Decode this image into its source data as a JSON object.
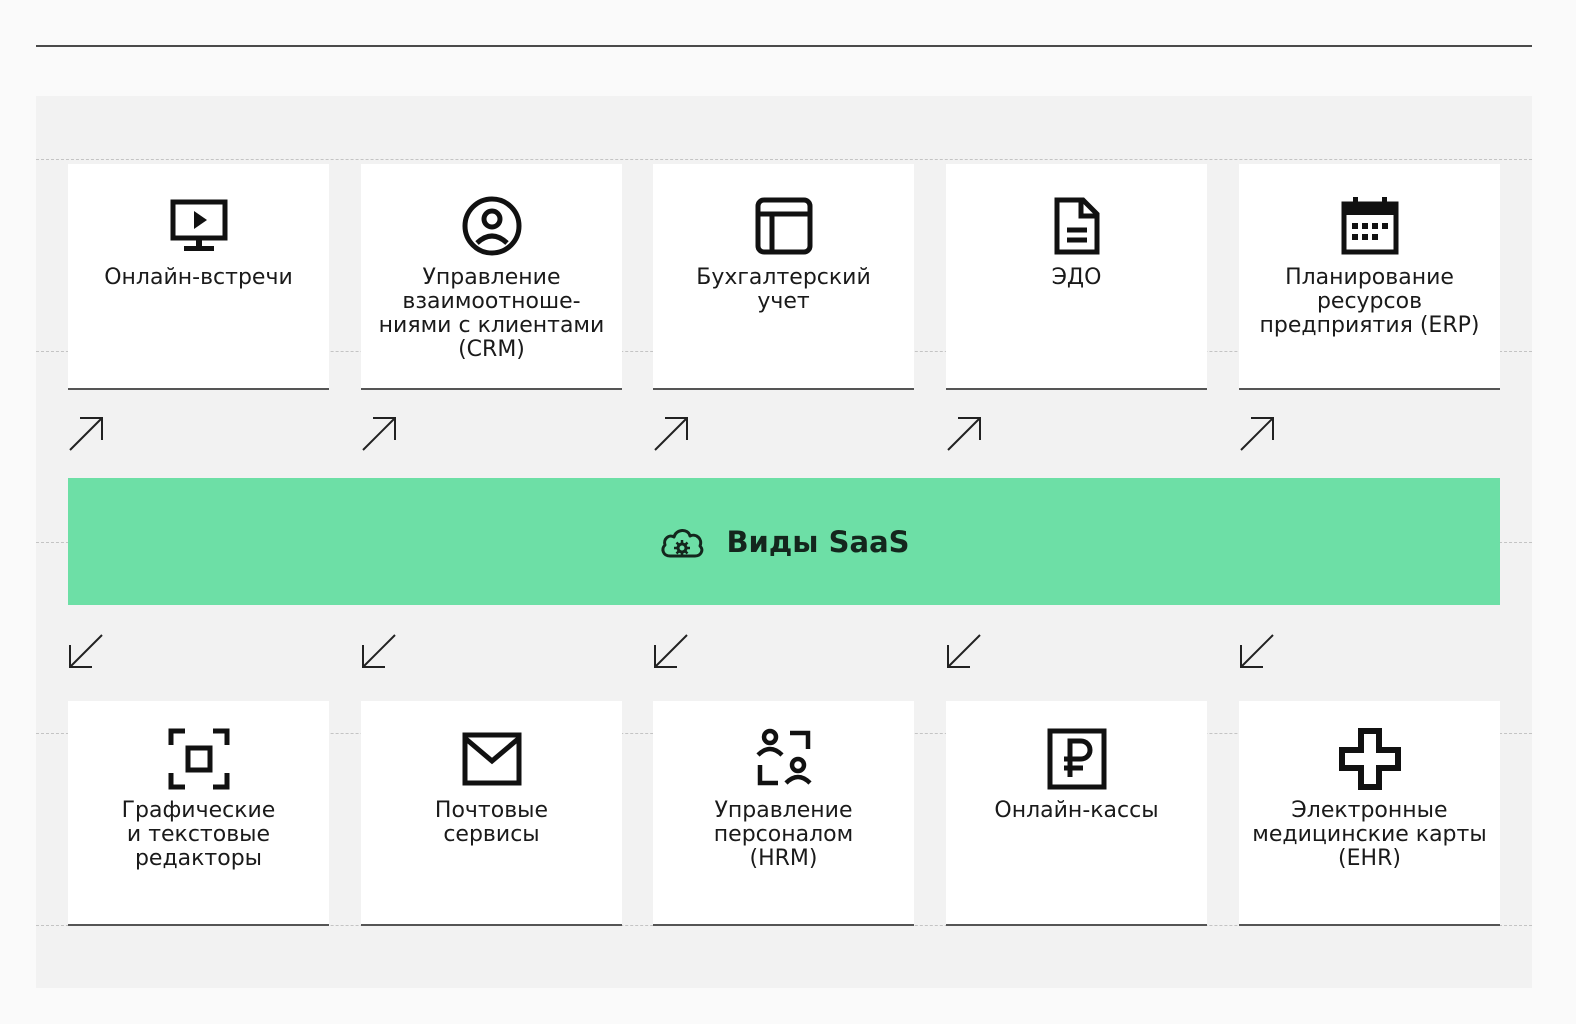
{
  "banner": {
    "title": "Виды SaaS",
    "icon": "cloud-gear-icon",
    "color": "#6ddfa6"
  },
  "top_cards": [
    {
      "label": "Онлайн-встречи",
      "icon": "monitor-play-icon"
    },
    {
      "label": "Управление\nвзаимоотноше-\nниями с клиентами\n(CRM)",
      "icon": "user-circle-icon"
    },
    {
      "label": "Бухгалтерский\nучет",
      "icon": "layout-grid-icon"
    },
    {
      "label": "ЭДО",
      "icon": "document-icon"
    },
    {
      "label": "Планирование\nресурсов\nпредприятия (ERP)",
      "icon": "calendar-icon"
    }
  ],
  "bottom_cards": [
    {
      "label": "Графические\nи текстовые\nредакторы",
      "icon": "focus-frame-icon"
    },
    {
      "label": "Почтовые\nсервисы",
      "icon": "envelope-icon"
    },
    {
      "label": "Управление\nперсоналом\n(HRM)",
      "icon": "people-swap-icon"
    },
    {
      "label": "Онлайн-кассы",
      "icon": "ruble-icon"
    },
    {
      "label": "Электронные\nмедицинские карты\n(EHR)",
      "icon": "medical-cross-icon"
    }
  ]
}
